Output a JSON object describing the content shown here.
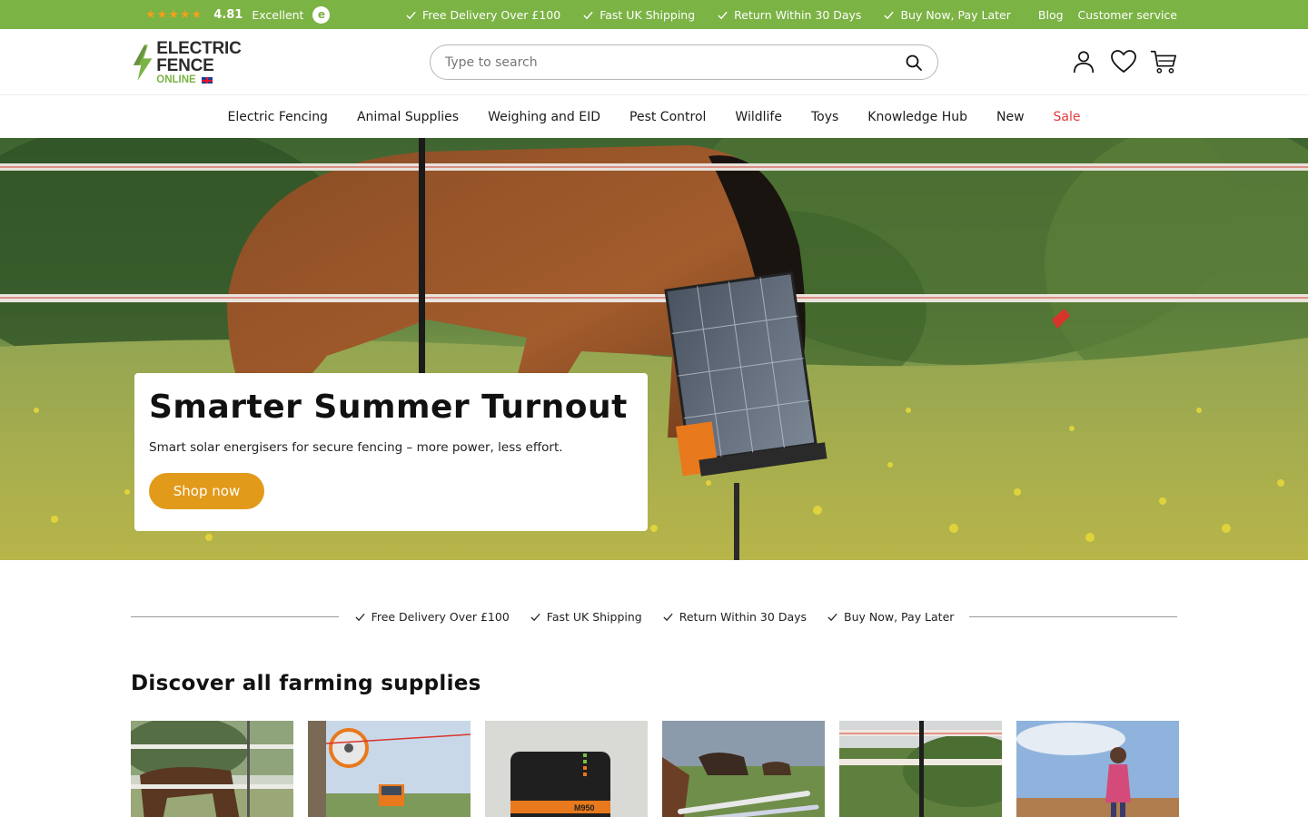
{
  "topbar": {
    "stars": "★★★★★",
    "score": "4.81",
    "rating_label": "Excellent",
    "badge_letter": "e",
    "usps": [
      "Free Delivery Over £100",
      "Fast UK Shipping",
      "Return Within 30 Days",
      "Buy Now, Pay Later"
    ],
    "links": [
      "Blog",
      "Customer service"
    ]
  },
  "header": {
    "logo_line1": "ELECTRIC FENCE",
    "logo_line2": "ONLINE",
    "search_placeholder": "Type to search",
    "icons": [
      "account-icon",
      "wishlist-heart-icon",
      "cart-icon"
    ]
  },
  "nav": {
    "items": [
      "Electric Fencing",
      "Animal Supplies",
      "Weighing and EID",
      "Pest Control",
      "Wildlife",
      "Toys",
      "Knowledge Hub",
      "New",
      "Sale"
    ]
  },
  "hero": {
    "title": "Smarter Summer Turnout",
    "subtitle": "Smart solar energisers for secure fencing – more power, less effort.",
    "cta": "Shop now"
  },
  "usp_band": {
    "items": [
      "Free Delivery Over £100",
      "Fast UK Shipping",
      "Return Within 30 Days",
      "Buy Now, Pay Later"
    ]
  },
  "discover": {
    "title": "Discover all farming supplies",
    "tiles": [
      "horse-fence-tile",
      "fence-reel-tile",
      "energiser-tile",
      "fence-handles-tile",
      "fence-post-tile",
      "child-field-tile"
    ],
    "energiser_model": "M950"
  },
  "colors": {
    "brand_green": "#7bb344",
    "accent_orange": "#e29a1a",
    "sale_red": "#e23b3b"
  }
}
